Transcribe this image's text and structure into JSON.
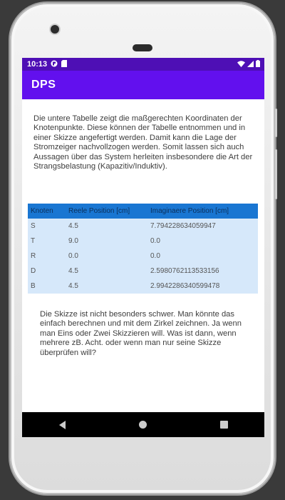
{
  "status_bar": {
    "time": "10:13",
    "left_icons": [
      "app-notification-icon",
      "sd-card-icon"
    ],
    "right_icons": [
      "wifi-icon",
      "signal-icon",
      "battery-icon"
    ]
  },
  "app_bar": {
    "title": "DPS"
  },
  "intro_text": "Die untere Tabelle zeigt die maßgerechten Koordinaten der Knotenpunkte. Diese können der Tabelle entnommen und in einer Skizze angefertigt werden. Damit kann die Lage der Stromzeiger nachvollzogen werden. Somit lassen sich auch Aussagen über das System herleiten insbesondere die Art der Strangsbelastung (Kapazitiv/Induktiv).",
  "table": {
    "headers": [
      "Knoten",
      "Reele Position [cm]",
      "Imaginaere Position [cm]"
    ],
    "rows": [
      [
        "S",
        "4.5",
        "7.794228634059947"
      ],
      [
        "T",
        "9.0",
        "0.0"
      ],
      [
        "R",
        "0.0",
        "0.0"
      ],
      [
        "D",
        "4.5",
        "2.5980762113533156"
      ],
      [
        "B",
        "4.5",
        "2.9942286340599478"
      ]
    ]
  },
  "outro_text": "Die Skizze ist nicht besonders schwer. Man könnte das einfach berechnen und mit dem Zirkel zeichnen. Ja wenn man Eins oder Zwei Skizzieren will. Was ist dann, wenn mehrere zB. Acht. oder wenn man nur seine Skizze überprüfen will?",
  "nav_bar": {
    "buttons": [
      "back-icon",
      "home-icon",
      "recents-icon"
    ]
  },
  "colors": {
    "status_bar": "#4e0fb5",
    "app_bar": "#6210ee",
    "table_header": "#1976d2",
    "table_row": "#d6e8fa"
  }
}
